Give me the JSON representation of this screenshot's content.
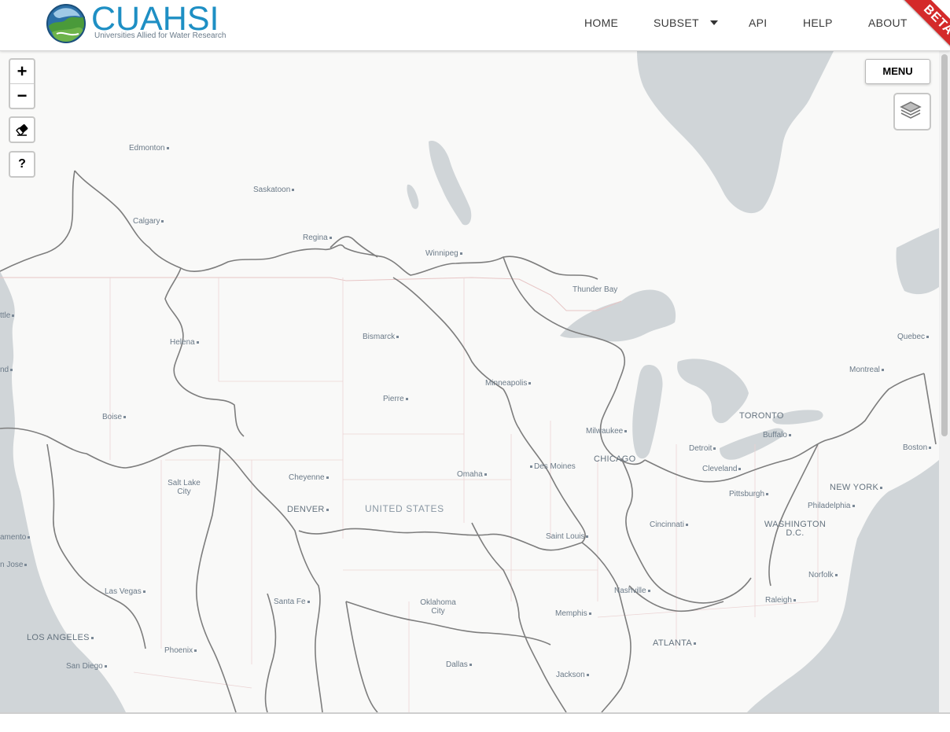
{
  "header": {
    "logo_text": "CUAHSI",
    "logo_tagline": "Universities Allied for Water Research",
    "nav": {
      "home": "HOME",
      "subset": "SUBSET",
      "api": "API",
      "help": "HELP",
      "about": "ABOUT"
    },
    "beta_ribbon": "BETA"
  },
  "map_controls": {
    "zoom_in": "+",
    "zoom_out": "−",
    "eraser_icon": "eraser-icon",
    "help": "?",
    "menu": "MENU",
    "layers_icon": "layers-icon"
  },
  "colors": {
    "brand_blue": "#1e8fc4",
    "beta_red": "#d42a2a",
    "water": "#d0d5d8",
    "land": "#f9f9f8",
    "basin_outline": "#7d7d7d",
    "state_border": "#e7c5c5"
  },
  "map_labels": {
    "edmonton": "Edmonton",
    "saskatoon": "Saskatoon",
    "calgary": "Calgary",
    "regina": "Regina",
    "winnipeg": "Winnipeg",
    "thunder_bay": "Thunder Bay",
    "seattle": "ttle",
    "helena": "Helena",
    "bismarck": "Bismarck",
    "quebec": "Quebec",
    "montreal": "Montreal",
    "minneapolis": "Minneapolis",
    "pierre": "Pierre",
    "boise": "Boise",
    "toronto": "TORONTO",
    "buffalo": "Buffalo",
    "milwaukee": "Milwaukee",
    "boston": "Boston",
    "detroit": "Detroit",
    "chicago": "CHICAGO",
    "des_moines": "Des Moines",
    "cleveland": "Cleveland",
    "omaha": "Omaha",
    "cheyenne": "Cheyenne",
    "salt_lake_city": "Salt Lake City",
    "new_york": "NEW YORK",
    "pittsburgh": "Pittsburgh",
    "philadelphia": "Philadelphia",
    "denver": "DENVER",
    "united_states": "UNITED STATES",
    "washington_dc": "WASHINGTON D.C.",
    "cincinnati": "Cincinnati",
    "sacramento": "amento",
    "saint_louis": "Saint Louis",
    "san_jose": "n Jose",
    "norfolk": "Norfolk",
    "las_vegas": "Las Vegas",
    "nashville": "Nashville",
    "raleigh": "Raleigh",
    "santa_fe": "Santa Fe",
    "oklahoma_city": "Oklahoma City",
    "memphis": "Memphis",
    "los_angeles": "LOS ANGELES",
    "atlanta": "ATLANTA",
    "phoenix": "Phoenix",
    "san_diego": "San Diego",
    "dallas": "Dallas",
    "jackson": "Jackson",
    "ind": "nd"
  }
}
